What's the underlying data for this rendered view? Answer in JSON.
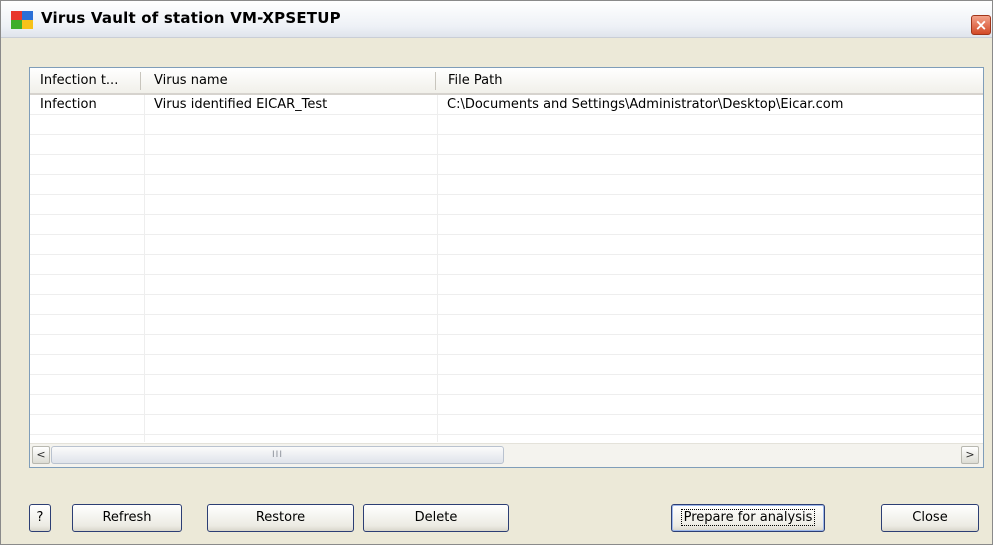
{
  "window": {
    "title": "Virus Vault of station VM-XPSETUP",
    "close_glyph": "×"
  },
  "table": {
    "columns": [
      "Infection t...",
      "Virus name",
      "File Path"
    ],
    "rows": [
      [
        "Infection",
        "Virus identified EICAR_Test",
        "C:\\Documents and Settings\\Administrator\\Desktop\\Eicar.com"
      ]
    ]
  },
  "scrollbar": {
    "left_arrow": "<",
    "right_arrow": ">",
    "grip": "III"
  },
  "buttons": {
    "help": "?",
    "refresh": "Refresh",
    "restore": "Restore",
    "delete": "Delete",
    "prepare": "Prepare for analysis",
    "close": "Close"
  },
  "colors": {
    "window_bg": "#ece9d8",
    "list_border": "#7f9db9",
    "close_button": "#d34a27"
  }
}
